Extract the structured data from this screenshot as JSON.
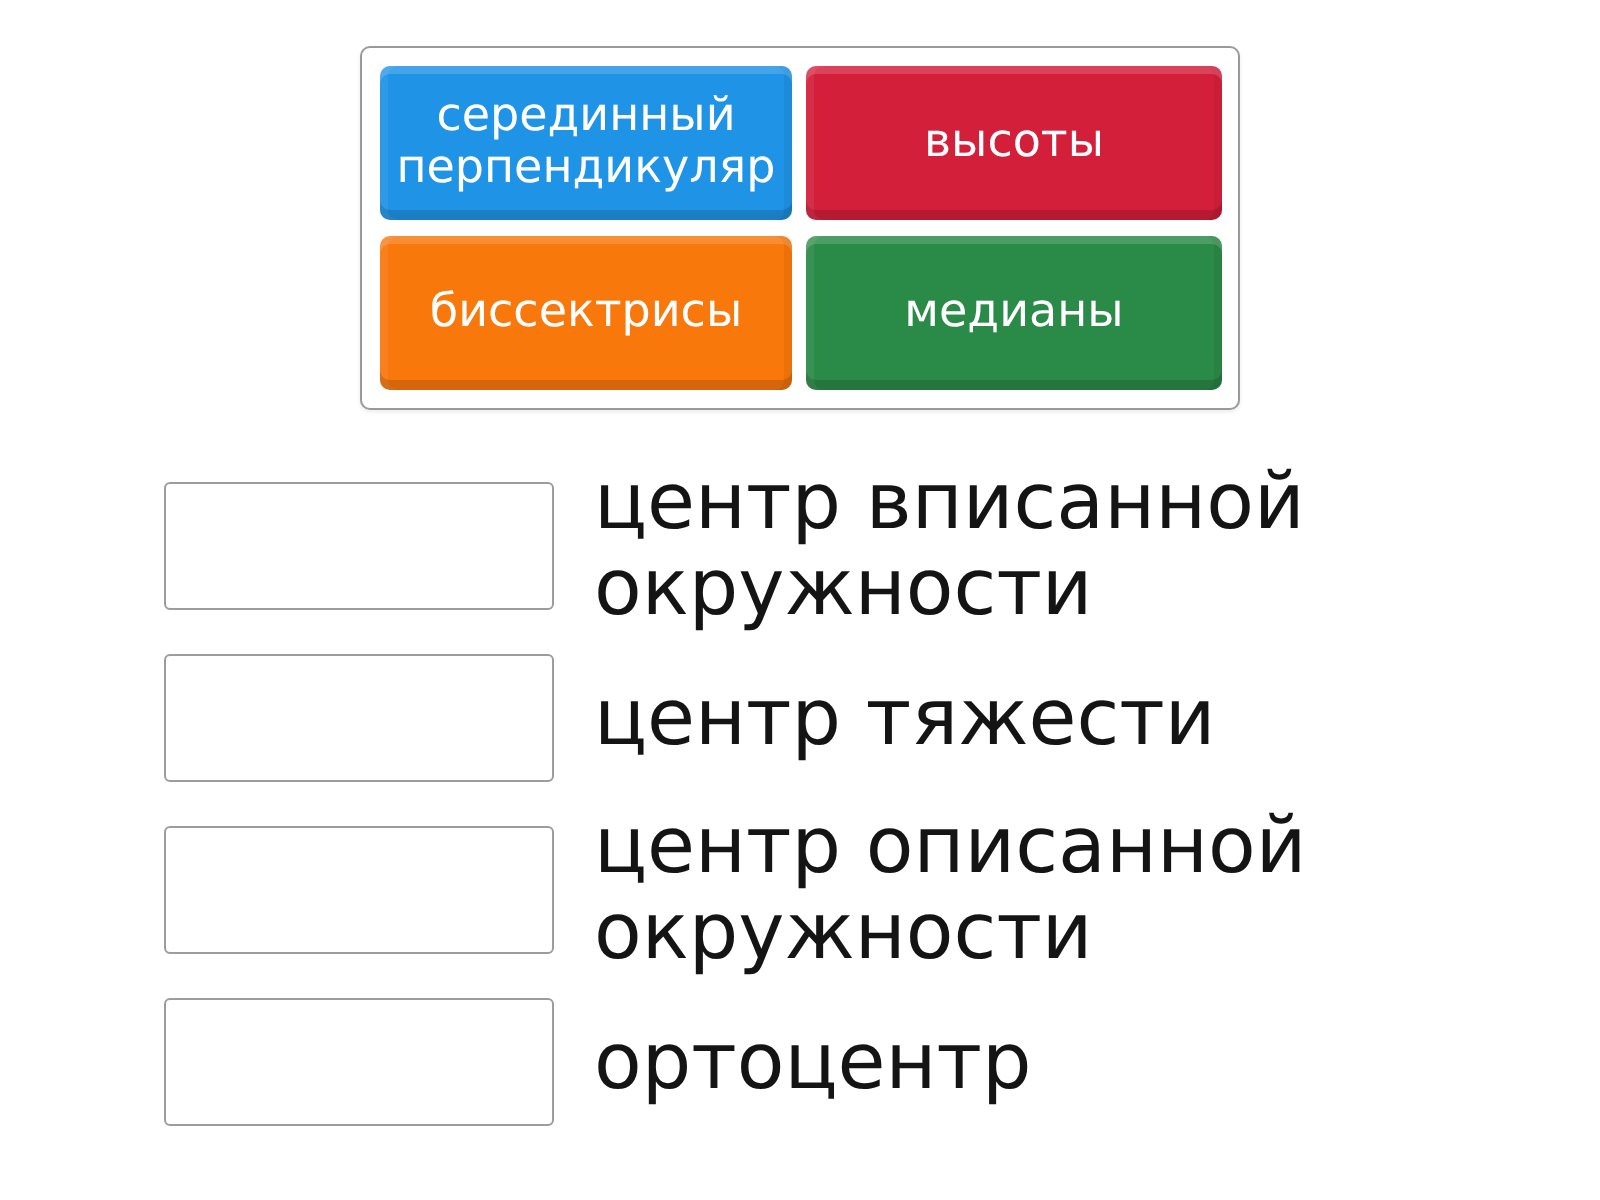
{
  "tiles": [
    {
      "label": "серединный перпендикуляр",
      "color": "#1f93e6"
    },
    {
      "label": "высоты",
      "color": "#d41f3b"
    },
    {
      "label": "биссектрисы",
      "color": "#f8780c"
    },
    {
      "label": "медианы",
      "color": "#2a8a48"
    }
  ],
  "rows": [
    {
      "prompt": "центр вписанной окружности"
    },
    {
      "prompt": "центр тяжести"
    },
    {
      "prompt": "центр описанной окружности"
    },
    {
      "prompt": "ортоцентр"
    }
  ]
}
